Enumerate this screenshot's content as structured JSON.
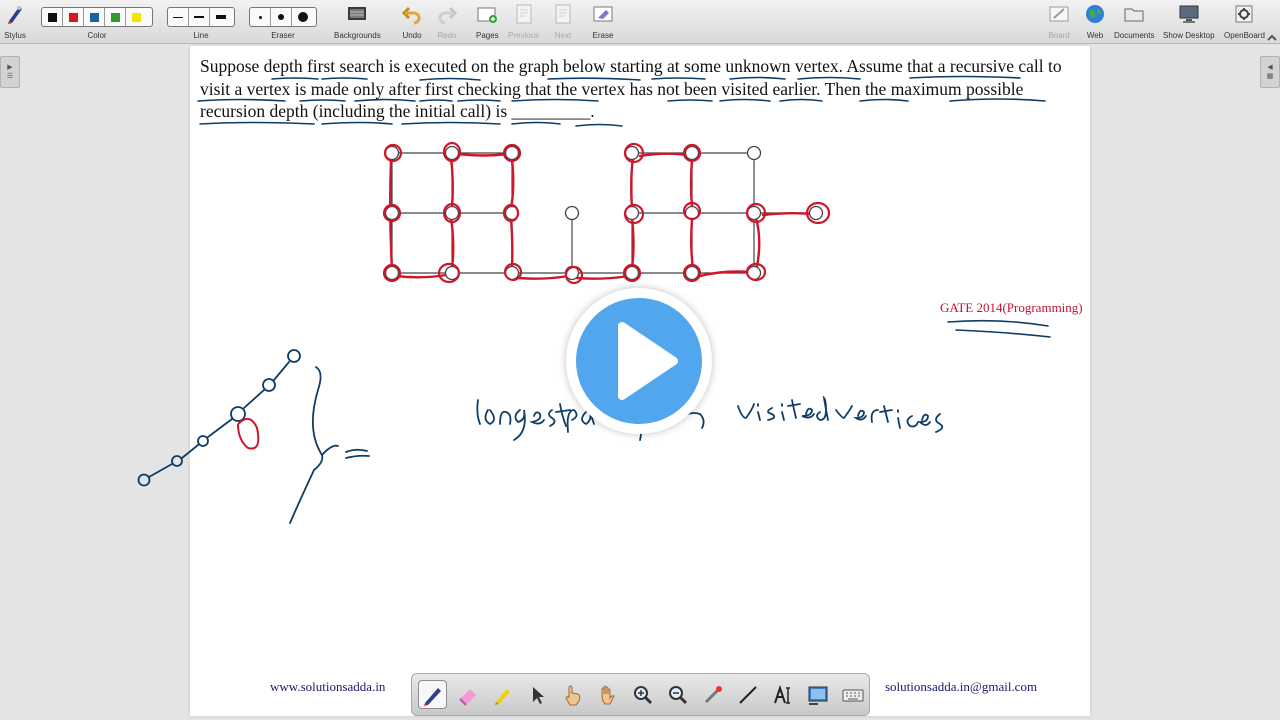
{
  "toolbar": {
    "stylus": "Stylus",
    "color": "Color",
    "line": "Line",
    "eraser": "Eraser",
    "backgrounds": "Backgrounds",
    "undo": "Undo",
    "redo": "Redo",
    "pages": "Pages",
    "previous": "Previous",
    "next": "Next",
    "erase": "Erase",
    "board": "Board",
    "web": "Web",
    "documents": "Documents",
    "show_desktop": "Show Desktop",
    "openboard": "OpenBoard",
    "colors": [
      "#111111",
      "#d7191c",
      "#1f5fa8",
      "#2a9d2a",
      "#f2e600"
    ]
  },
  "board": {
    "question": "Suppose depth first search is executed on the graph below starting at some unknown vertex. Assume that a recursive call to visit a vertex is made only after first checking that the vertex has not been visited earlier. Then the maximum possible recursion depth (including the initial call) is _________.",
    "source_label": "GATE 2014(Programming)",
    "ink_accent": "#d0162b",
    "ink_blue": "#0f3d66"
  },
  "footer": {
    "website": "www.solutionsadda.in",
    "email": "solutionsadda.in@gmail.com"
  },
  "palette_tools": [
    "pen",
    "eraser",
    "highlighter",
    "selector",
    "interactor",
    "hand",
    "zoom-in",
    "zoom-out",
    "laser-pointer",
    "line",
    "text",
    "capture",
    "keyboard"
  ]
}
